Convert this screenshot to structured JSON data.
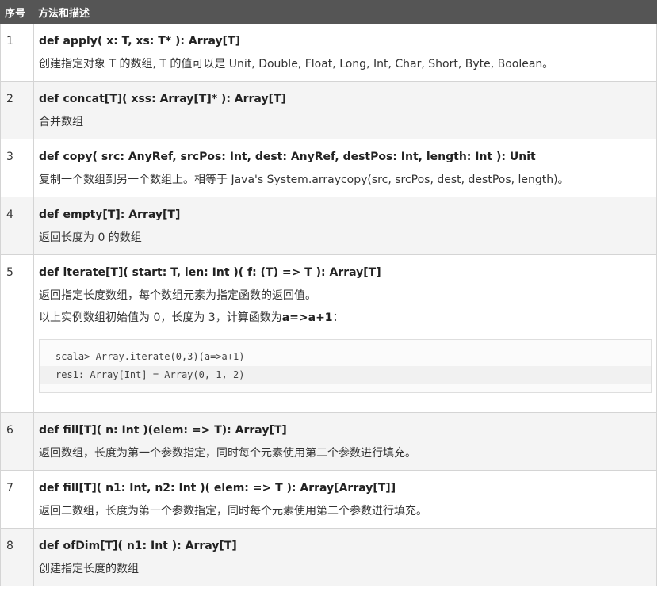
{
  "header": {
    "col_num": "序号",
    "col_desc": "方法和描述"
  },
  "rows": [
    {
      "num": "1",
      "sig": "def apply( x: T, xs: T* ): Array[T]",
      "desc": "创建指定对象 T 的数组, T 的值可以是 Unit, Double, Float, Long, Int, Char, Short, Byte, Boolean。"
    },
    {
      "num": "2",
      "sig": "def concat[T]( xss: Array[T]* ): Array[T]",
      "desc": "合并数组"
    },
    {
      "num": "3",
      "sig": "def copy( src: AnyRef, srcPos: Int, dest: AnyRef, destPos: Int, length: Int ): Unit",
      "desc": "复制一个数组到另一个数组上。相等于 Java's System.arraycopy(src, srcPos, dest, destPos, length)。"
    },
    {
      "num": "4",
      "sig": "def empty[T]: Array[T]",
      "desc": "返回长度为 0 的数组"
    },
    {
      "num": "5",
      "sig": "def iterate[T]( start: T, len: Int )( f: (T) => T ): Array[T]",
      "desc": "返回指定长度数组，每个数组元素为指定函数的返回值。",
      "example_prefix": "以上实例数组初始值为 0，长度为 3，计算函数为",
      "example_bold": "a=>a+1",
      "example_suffix": "：",
      "code": [
        "scala> Array.iterate(0,3)(a=>a+1)",
        "res1: Array[Int] = Array(0, 1, 2)"
      ]
    },
    {
      "num": "6",
      "sig": "def fill[T]( n: Int )(elem: => T): Array[T]",
      "desc": "返回数组，长度为第一个参数指定，同时每个元素使用第二个参数进行填充。"
    },
    {
      "num": "7",
      "sig": "def fill[T]( n1: Int, n2: Int )( elem: => T ): Array[Array[T]]",
      "desc": "返回二数组，长度为第一个参数指定，同时每个元素使用第二个参数进行填充。"
    },
    {
      "num": "8",
      "sig": "def ofDim[T]( n1: Int ): Array[T]",
      "desc": "创建指定长度的数组"
    }
  ]
}
